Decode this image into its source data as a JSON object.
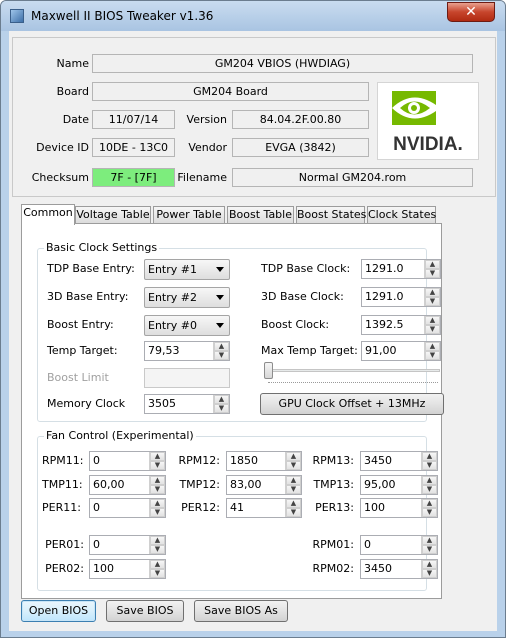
{
  "window": {
    "title": "Maxwell II BIOS Tweaker v1.36",
    "close_glyph": "✕"
  },
  "info": {
    "name_label": "Name",
    "name": "GM204 VBIOS (HWDIAG)",
    "board_label": "Board",
    "board": "GM204 Board",
    "date_label": "Date",
    "date": "11/07/14",
    "version_label": "Version",
    "version": "84.04.2F.00.80",
    "device_id_label": "Device ID",
    "device_id": "10DE - 13C0",
    "vendor_label": "Vendor",
    "vendor": "EVGA (3842)",
    "checksum_label": "Checksum",
    "checksum": "7F - [7F]",
    "filename_label": "Filename",
    "filename": "Normal GM204.rom",
    "logo_text": "NVIDIA."
  },
  "tabs": [
    "Common",
    "Voltage Table",
    "Power Table",
    "Boost Table",
    "Boost States",
    "Clock States"
  ],
  "basic": {
    "title": "Basic Clock Settings",
    "tdp_base_entry_label": "TDP Base Entry:",
    "tdp_base_entry": "Entry #1",
    "base_3d_entry_label": "3D Base Entry:",
    "base_3d_entry": "Entry #2",
    "boost_entry_label": "Boost Entry:",
    "boost_entry": "Entry #0",
    "temp_target_label": "Temp Target:",
    "temp_target": "79,53",
    "boost_limit_label": "Boost Limit",
    "memory_clock_label": "Memory Clock",
    "memory_clock": "3505",
    "tdp_base_clock_label": "TDP Base Clock:",
    "tdp_base_clock": "1291.0",
    "clock_3d_base_label": "3D Base Clock:",
    "clock_3d_base": "1291.0",
    "boost_clock_label": "Boost Clock:",
    "boost_clock": "1392.5",
    "max_temp_target_label": "Max Temp Target:",
    "max_temp_target": "91,00",
    "gpu_offset_button": "GPU Clock Offset + 13MHz"
  },
  "fan": {
    "title": "Fan Control (Experimental)",
    "rpm11_label": "RPM11:",
    "rpm11": "0",
    "tmp11_label": "TMP11:",
    "tmp11": "60,00",
    "per11_label": "PER11:",
    "per11": "0",
    "rpm12_label": "RPM12:",
    "rpm12": "1850",
    "tmp12_label": "TMP12:",
    "tmp12": "83,00",
    "per12_label": "PER12:",
    "per12": "41",
    "rpm13_label": "RPM13:",
    "rpm13": "3450",
    "tmp13_label": "TMP13:",
    "tmp13": "95,00",
    "per13_label": "PER13:",
    "per13": "100",
    "per01_label": "PER01:",
    "per01": "0",
    "per02_label": "PER02:",
    "per02": "100",
    "rpm01_label": "RPM01:",
    "rpm01": "0",
    "rpm02_label": "RPM02:",
    "rpm02": "3450"
  },
  "buttons": {
    "open": "Open BIOS",
    "save": "Save BIOS",
    "save_as": "Save BIOS As"
  },
  "spin": {
    "up": "▲",
    "down": "▼"
  },
  "colors": {
    "checksum_ok": "#7ded7d",
    "nvidia_green": "#76b900",
    "titlebar": "#b9d1ea"
  }
}
